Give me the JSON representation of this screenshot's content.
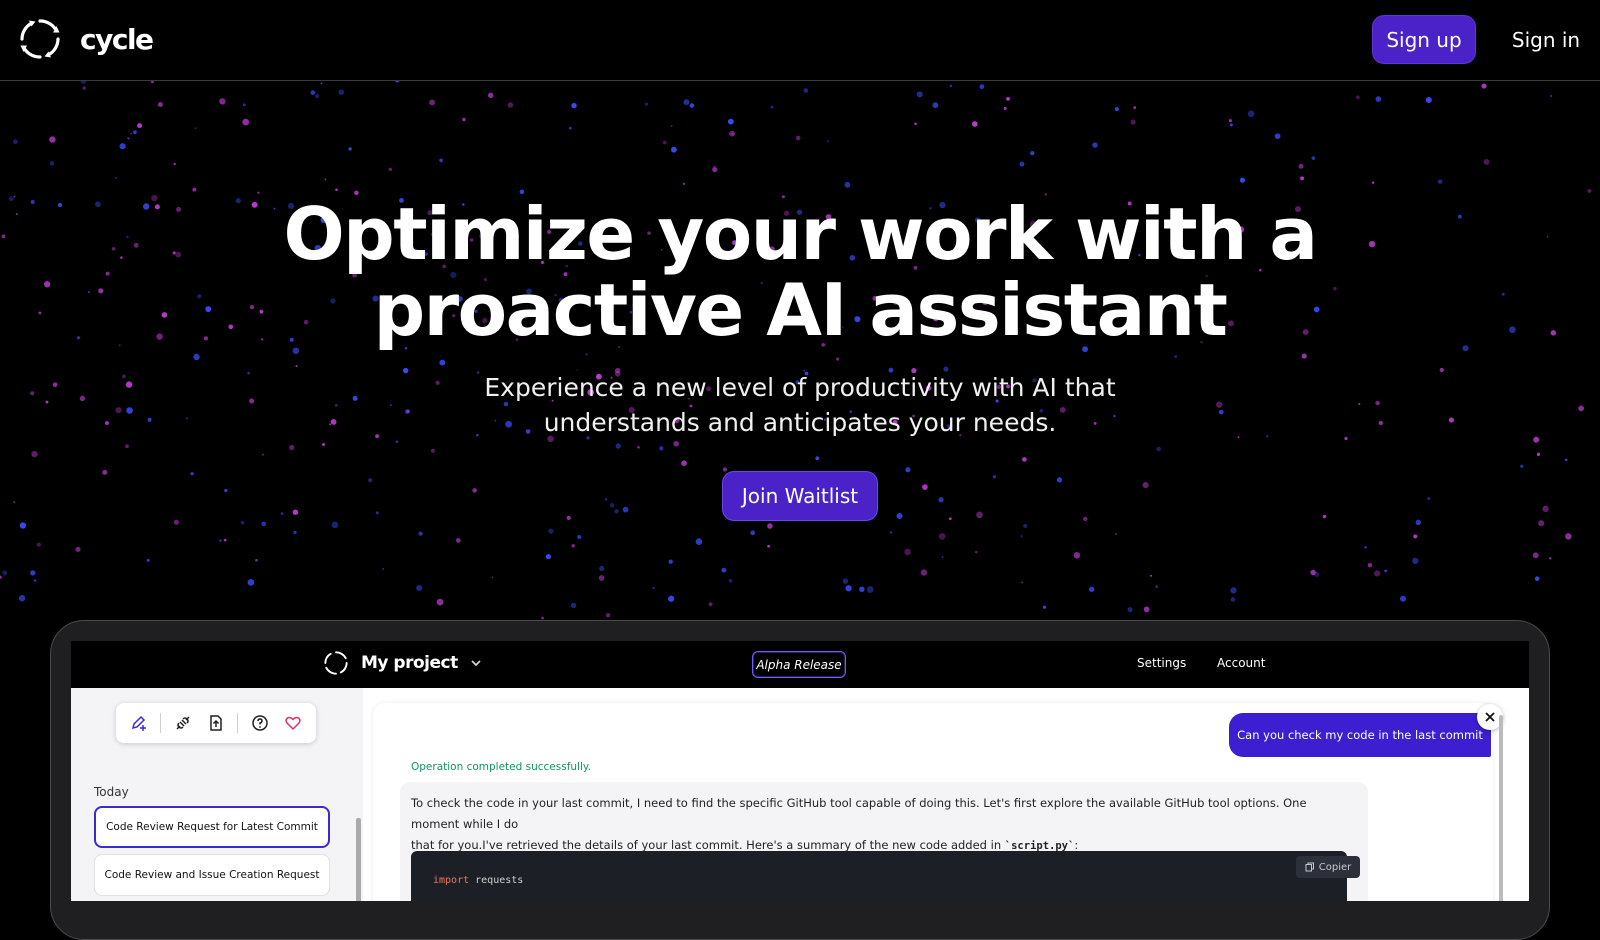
{
  "brand": {
    "name": "cycle",
    "icon": "cycle-logo-icon"
  },
  "nav": {
    "signup_label": "Sign up",
    "signin_label": "Sign in"
  },
  "hero": {
    "title_line1": "Optimize your work with a",
    "title_line2": "proactive AI assistant",
    "subtitle_line1": "Experience a new level of productivity with AI that",
    "subtitle_line2": "understands and anticipates your needs.",
    "cta_label": "Join Waitlist"
  },
  "colors": {
    "background": "#000000",
    "accent": "#4b22c8",
    "particle_pink": "#c43cd8",
    "particle_blue": "#3d4dff",
    "user_bubble": "#3d1ed0",
    "success_text": "#0f9560"
  },
  "app": {
    "project_name": "My project",
    "release_badge": "Alpha Release",
    "nav": {
      "settings": "Settings",
      "account": "Account"
    },
    "toolbar_icons": [
      "new-chat-icon",
      "plug-icon",
      "file-upload-icon",
      "help-icon",
      "heart-icon"
    ],
    "sidebar": {
      "section_label": "Today",
      "items": [
        {
          "label": "Code Review Request for Latest Commit",
          "active": true
        },
        {
          "label": "Code Review and Issue Creation Request",
          "active": false
        }
      ]
    },
    "chat": {
      "user_message": "Can you check my code in the last commit",
      "status": "Operation completed successfully.",
      "assistant_line1": "To check the code in your last commit, I need to find the specific GitHub tool capable of doing this. Let's first explore the available GitHub tool options. One moment while I do",
      "assistant_line2_prefix": "that for you.I've retrieved the details of your last commit. Here's a summary of the new code added in ",
      "assistant_file": "`script.py`",
      "assistant_line2_suffix": ":",
      "copy_label": "Copier",
      "code_keyword": "import",
      "code_rest": " requests"
    }
  }
}
